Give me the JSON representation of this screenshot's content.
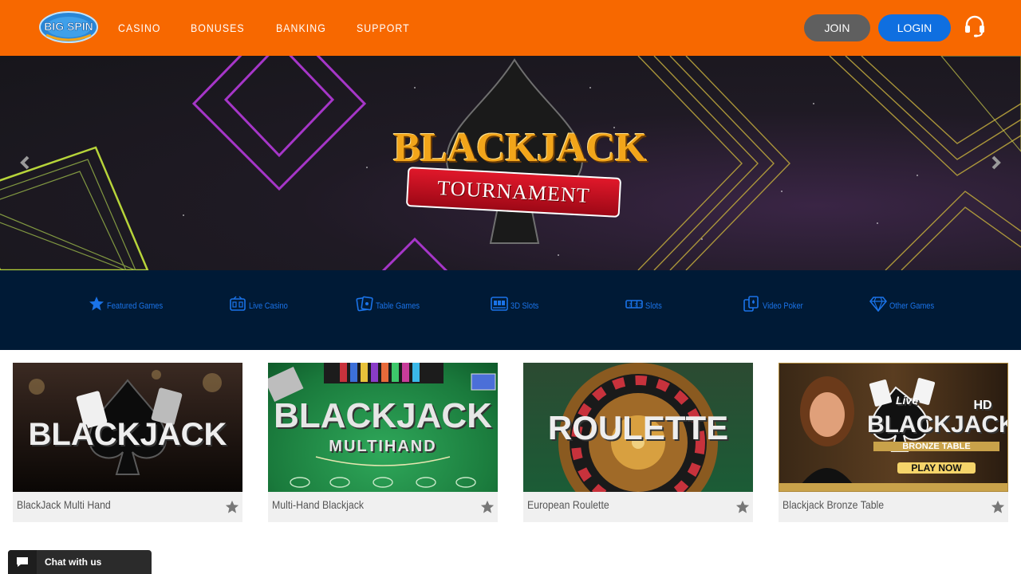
{
  "header": {
    "logo_text": "BIG SPIN",
    "nav": [
      {
        "label": "CASINO"
      },
      {
        "label": "BONUSES"
      },
      {
        "label": "BANKING"
      },
      {
        "label": "SUPPORT"
      }
    ],
    "join_label": "JOIN",
    "login_label": "LOGIN",
    "support_icon": "headset-icon"
  },
  "banner": {
    "title": "BLACKJACK",
    "subtitle": "TOURNAMENT",
    "prev_icon": "chevron-left-icon",
    "next_icon": "chevron-right-icon"
  },
  "categories": [
    {
      "label": "Featured Games",
      "icon": "star-icon"
    },
    {
      "label": "Live Casino",
      "icon": "live-casino-icon"
    },
    {
      "label": "Table Games",
      "icon": "cards-icon"
    },
    {
      "label": "3D Slots",
      "icon": "slot-machine-icon"
    },
    {
      "label": "Slots",
      "icon": "slots-reel-icon"
    },
    {
      "label": "Video Poker",
      "icon": "poker-cards-icon"
    },
    {
      "label": "Other Games",
      "icon": "diamond-icon"
    }
  ],
  "games": [
    {
      "title": "BlackJack Multi Hand",
      "art_text": "BLACKJACK",
      "art_sub": ""
    },
    {
      "title": "Multi-Hand Blackjack",
      "art_text": "BLACKJACK",
      "art_sub": "MULTIHAND"
    },
    {
      "title": "European Roulette",
      "art_text": "ROULETTE",
      "art_sub": ""
    },
    {
      "title": "Blackjack Bronze Table",
      "art_text": "BLACKJACK",
      "art_sub": "BRONZE TABLE",
      "art_badge": "Live",
      "art_hd": "HD",
      "art_cta": "PLAY NOW"
    }
  ],
  "chat": {
    "label": "Chat with us"
  },
  "colors": {
    "header_bg": "#f76800",
    "login_bg": "#0f6fe0",
    "join_bg": "#5f5f5f",
    "category_bar_bg": "#001a36",
    "category_text": "#1a73e8"
  }
}
